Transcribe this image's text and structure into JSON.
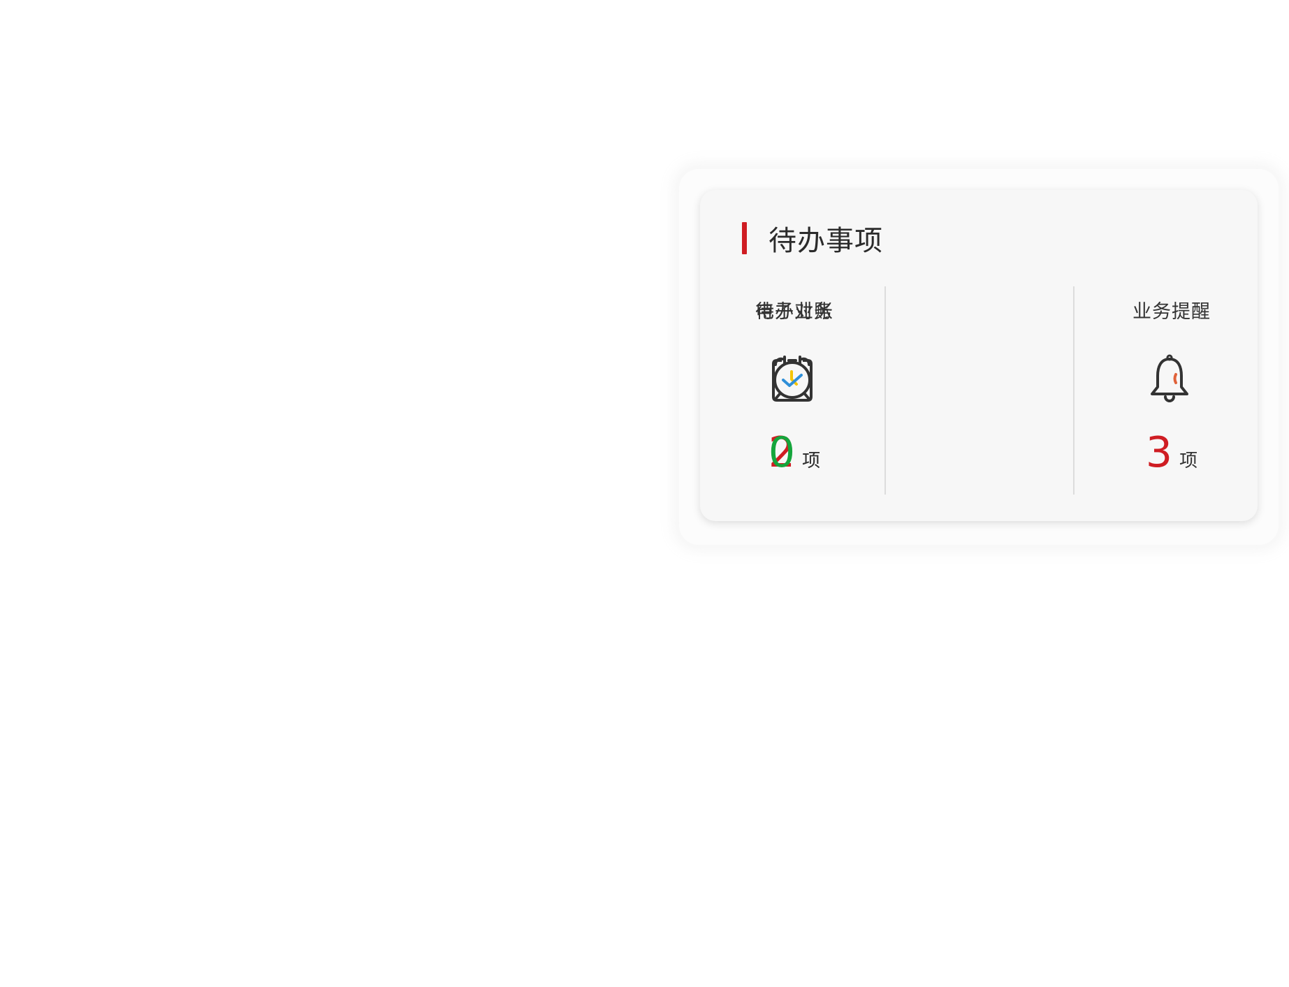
{
  "todo_panel": {
    "title": "待办事项",
    "accent_color": "#cf1d23",
    "items": [
      {
        "label": "待办业务",
        "icon": "alarm-clock-icon",
        "count": "2",
        "unit": "项",
        "count_color": "#cf1d23"
      },
      {
        "label": "业务提醒",
        "icon": "bell-icon",
        "count": "3",
        "unit": "项",
        "count_color": "#cf1d23"
      },
      {
        "label": "电子对账",
        "icon": "checked-clipboard-icon",
        "count": "0",
        "unit": "项",
        "count_color": "#15a53c"
      }
    ]
  }
}
